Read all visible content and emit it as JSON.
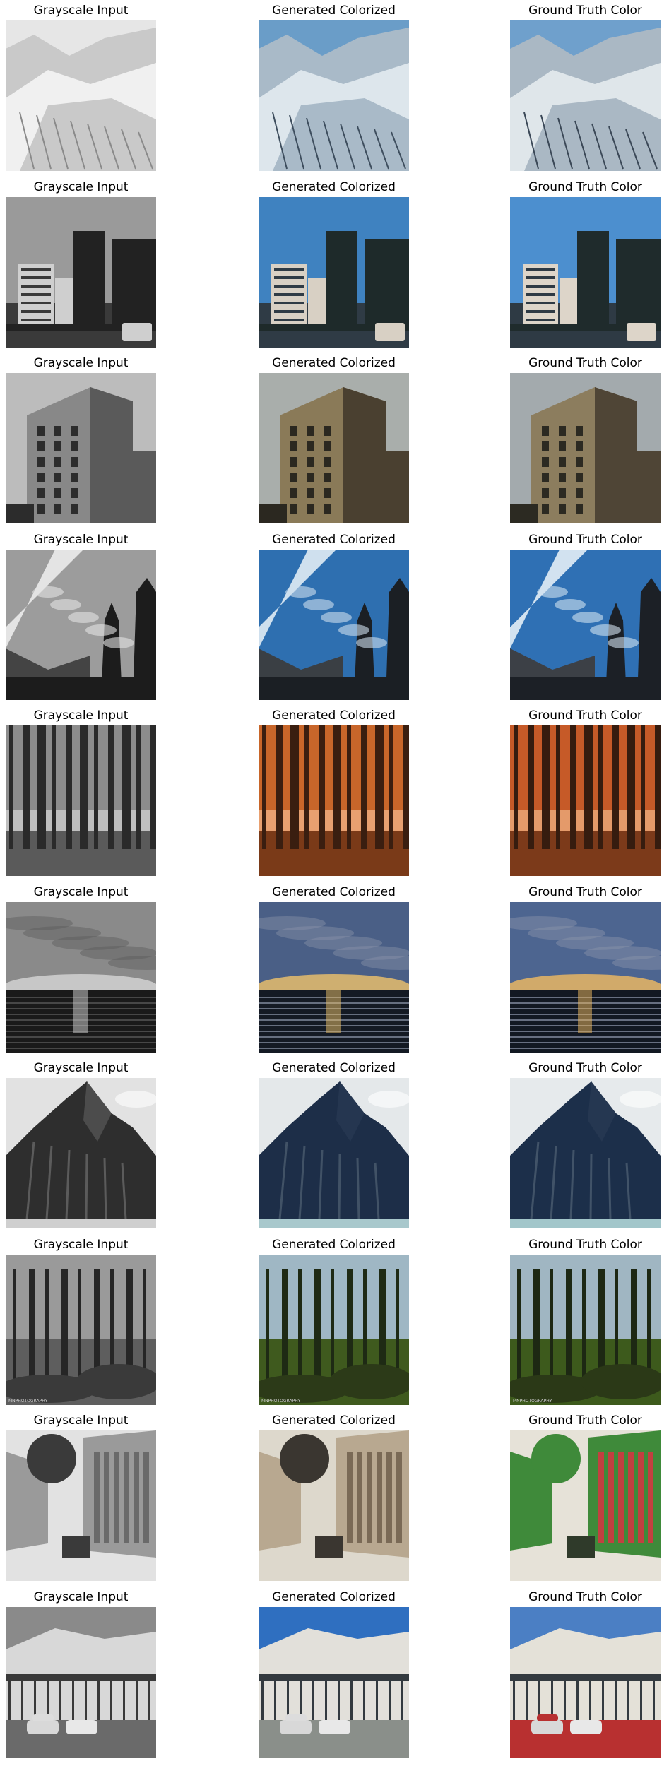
{
  "columns": [
    {
      "title": "Grayscale Input"
    },
    {
      "title": "Generated Colorized"
    },
    {
      "title": "Ground Truth Color"
    }
  ],
  "rows": [
    {
      "scene": "glacier",
      "gray": [
        "#e6e6e6",
        "#8a8a8a",
        "#c9c9c9",
        "#f0f0f0"
      ],
      "gen": [
        "#6a9dc8",
        "#3e4e5e",
        "#a9bac8",
        "#dde6ec"
      ],
      "gt": [
        "#6fa0cc",
        "#3b4857",
        "#aab8c4",
        "#dfe6ea"
      ]
    },
    {
      "scene": "city",
      "gray": [
        "#9a9a9a",
        "#3a3a3a",
        "#cfcfcf",
        "#222222"
      ],
      "gen": [
        "#3f82c0",
        "#2f3b45",
        "#d8d0c4",
        "#1e2a2a"
      ],
      "gt": [
        "#4c8fcf",
        "#2e3a44",
        "#ddd5c9",
        "#1f2b2c"
      ]
    },
    {
      "scene": "building",
      "gray": [
        "#bcbcbc",
        "#5a5a5a",
        "#888888",
        "#2c2c2c"
      ],
      "gen": [
        "#a9aeab",
        "#4a4030",
        "#8a7a58",
        "#2b2820"
      ],
      "gt": [
        "#a3aaad",
        "#4f4536",
        "#8c7d5e",
        "#2c2a22"
      ]
    },
    {
      "scene": "church",
      "gray": [
        "#9c9c9c",
        "#e4e4e4",
        "#444444",
        "#1c1c1c"
      ],
      "gen": [
        "#2e6fb0",
        "#cfe0ee",
        "#3a3f44",
        "#1b1f24"
      ],
      "gt": [
        "#2f70b4",
        "#d2e2f0",
        "#3c4046",
        "#1c2026"
      ]
    },
    {
      "scene": "forest-autumn",
      "gray": [
        "#bfbfbf",
        "#2a2a2a",
        "#8c8c8c",
        "#5a5a5a"
      ],
      "gen": [
        "#e8a070",
        "#3a1e10",
        "#c8662a",
        "#7a3a18"
      ],
      "gt": [
        "#e49a6a",
        "#361c0f",
        "#c65a28",
        "#7c3a1a"
      ]
    },
    {
      "scene": "sea-sunset",
      "gray": [
        "#8a8a8a",
        "#d6d6d6",
        "#1a1a1a",
        "#5a5a5a"
      ],
      "gen": [
        "#4a5f86",
        "#f0c36a",
        "#141a24",
        "#8a93a8"
      ],
      "gt": [
        "#4d6590",
        "#f2bb60",
        "#121822",
        "#8b94aa"
      ]
    },
    {
      "scene": "mountain",
      "gray": [
        "#e2e2e2",
        "#2e2e2e",
        "#7a7a7a",
        "#cfcfcf"
      ],
      "gen": [
        "#e4e8ea",
        "#1d2e48",
        "#5a6a7a",
        "#a8c8cc"
      ],
      "gt": [
        "#e6eaec",
        "#1c2f4a",
        "#5b6b7c",
        "#a2c6ca"
      ]
    },
    {
      "scene": "forest-green",
      "gray": [
        "#9a9a9a",
        "#262626",
        "#5e5e5e",
        "#3a3a3a"
      ],
      "gen": [
        "#9fb7c4",
        "#1e2a14",
        "#3f5a1e",
        "#2c3a18"
      ],
      "gt": [
        "#a0b6c2",
        "#1d2813",
        "#3d5a1c",
        "#2b3917"
      ]
    },
    {
      "scene": "street",
      "gray": [
        "#e2e2e2",
        "#3a3a3a",
        "#9a9a9a",
        "#6a6a6a"
      ],
      "gen": [
        "#ddd8cc",
        "#3a3630",
        "#b8a890",
        "#7a6a56"
      ],
      "gt": [
        "#e6e2d8",
        "#2f3a2a",
        "#3f8a3a",
        "#c24040"
      ]
    },
    {
      "scene": "storefront",
      "gray": [
        "#8a8a8a",
        "#d8d8d8",
        "#3a3a3a",
        "#6a6a6a"
      ],
      "gen": [
        "#2f6fc0",
        "#e2e0da",
        "#333a3f",
        "#8a8f8a"
      ],
      "gt": [
        "#4b7fc4",
        "#e4e1d8",
        "#343b40",
        "#b83030"
      ]
    }
  ],
  "caption": "MNPHOTOGRAPHY"
}
